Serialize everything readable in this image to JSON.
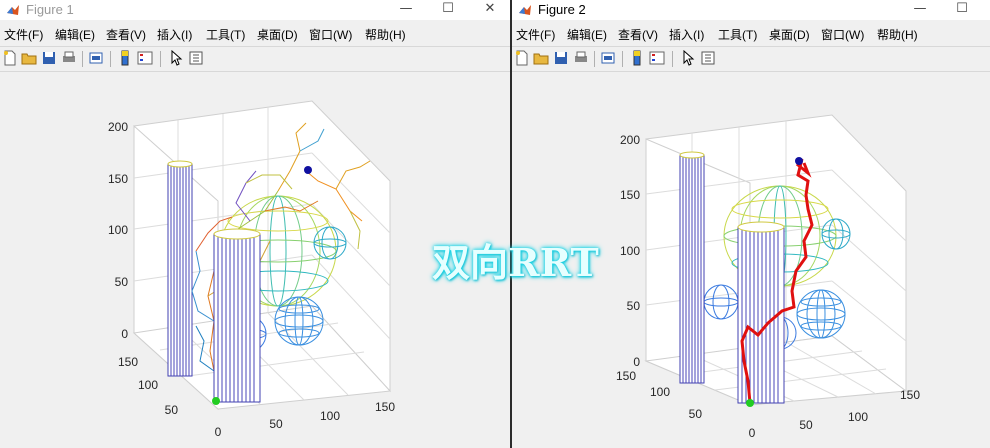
{
  "figure1": {
    "title": "Figure 1",
    "menu": [
      "文件(F)",
      "编辑(E)",
      "查看(V)",
      "插入(I)",
      "工具(T)",
      "桌面(D)",
      "窗口(W)",
      "帮助(H)"
    ],
    "yticks": [
      "0",
      "50",
      "100",
      "150",
      "200"
    ],
    "xticks": [
      "0",
      "50",
      "100",
      "150"
    ],
    "depth_ticks": [
      "50",
      "100",
      "150"
    ]
  },
  "figure2": {
    "title": "Figure 2",
    "menu": [
      "文件(F)",
      "编辑(E)",
      "查看(V)",
      "插入(I)",
      "工具(T)",
      "桌面(D)",
      "窗口(W)",
      "帮助(H)"
    ],
    "yticks": [
      "0",
      "50",
      "100",
      "150",
      "200"
    ],
    "xticks": [
      "0",
      "50",
      "100",
      "150"
    ],
    "depth_ticks": [
      "50",
      "100",
      "150"
    ]
  },
  "window_buttons": {
    "minimize": "—",
    "maximize": "☐",
    "close": "✕"
  },
  "overlay_text": "双向RRT",
  "icons": [
    "new-figure-icon",
    "open-file-icon",
    "save-icon",
    "print-icon",
    "print-preview-icon",
    "colorbar-icon",
    "legend-icon",
    "pointer-icon",
    "property-editor-icon"
  ],
  "colors": {
    "cylinder": "#4040b0",
    "start": "#22cc22",
    "goal": "#1010a0",
    "path": "#e01010"
  }
}
